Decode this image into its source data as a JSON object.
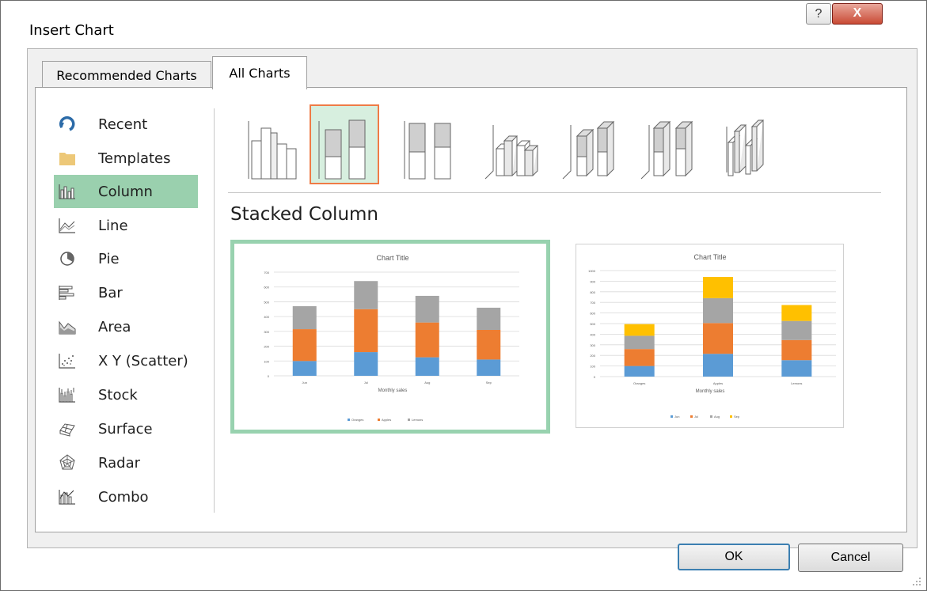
{
  "dialog": {
    "title": "Insert Chart",
    "help_label": "?",
    "close_label": "X"
  },
  "tabs": [
    {
      "label": "Recommended Charts",
      "active": false
    },
    {
      "label": "All Charts",
      "active": true
    }
  ],
  "sidebar": {
    "items": [
      {
        "label": "Recent",
        "icon": "recent-icon"
      },
      {
        "label": "Templates",
        "icon": "folder-icon"
      },
      {
        "label": "Column",
        "icon": "column-chart-icon",
        "selected": true
      },
      {
        "label": "Line",
        "icon": "line-chart-icon"
      },
      {
        "label": "Pie",
        "icon": "pie-chart-icon"
      },
      {
        "label": "Bar",
        "icon": "bar-chart-icon"
      },
      {
        "label": "Area",
        "icon": "area-chart-icon"
      },
      {
        "label": "X Y (Scatter)",
        "icon": "scatter-chart-icon"
      },
      {
        "label": "Stock",
        "icon": "stock-chart-icon"
      },
      {
        "label": "Surface",
        "icon": "surface-chart-icon"
      },
      {
        "label": "Radar",
        "icon": "radar-chart-icon"
      },
      {
        "label": "Combo",
        "icon": "combo-chart-icon"
      }
    ]
  },
  "subtypes": [
    {
      "icon": "clustered-column-icon"
    },
    {
      "icon": "stacked-column-icon",
      "selected": true
    },
    {
      "icon": "100-stacked-column-icon"
    },
    {
      "icon": "3d-clustered-column-icon"
    },
    {
      "icon": "3d-stacked-column-icon"
    },
    {
      "icon": "3d-100-stacked-column-icon"
    },
    {
      "icon": "3d-column-icon"
    }
  ],
  "main": {
    "heading": "Stacked Column"
  },
  "colors": {
    "blue": "#5b9bd5",
    "orange": "#ed7d31",
    "gray": "#a5a5a5",
    "yellow": "#ffc000",
    "selection": "#9ad0ae",
    "subtype_border": "#ef7b46"
  },
  "chart_data": [
    {
      "type": "bar",
      "stacked": true,
      "title": "Chart Title",
      "xlabel": "Monthly sales",
      "categories": [
        "Jun",
        "Jul",
        "Aug",
        "Sep"
      ],
      "series": [
        {
          "name": "Oranges",
          "values": [
            100,
            160,
            125,
            110
          ],
          "color": "#5b9bd5"
        },
        {
          "name": "Apples",
          "values": [
            215,
            290,
            235,
            200
          ],
          "color": "#ed7d31"
        },
        {
          "name": "Lemons",
          "values": [
            155,
            190,
            180,
            150
          ],
          "color": "#a5a5a5"
        }
      ],
      "ylim": [
        0,
        700
      ],
      "yticks": [
        "700",
        "600",
        "500",
        "400",
        "300",
        "200",
        "100",
        "0"
      ],
      "legend": "bottom",
      "grid": true
    },
    {
      "type": "bar",
      "stacked": true,
      "title": "Chart Title",
      "xlabel": "Monthly sales",
      "categories": [
        "Oranges",
        "Apples",
        "Lemons"
      ],
      "series": [
        {
          "name": "Jun",
          "values": [
            100,
            215,
            155
          ],
          "color": "#5b9bd5"
        },
        {
          "name": "Jul",
          "values": [
            160,
            290,
            190
          ],
          "color": "#ed7d31"
        },
        {
          "name": "Aug",
          "values": [
            125,
            235,
            180
          ],
          "color": "#a5a5a5"
        },
        {
          "name": "Sep",
          "values": [
            110,
            200,
            150
          ],
          "color": "#ffc000"
        }
      ],
      "ylim": [
        0,
        1000
      ],
      "yticks": [
        "1000",
        "900",
        "800",
        "700",
        "600",
        "500",
        "400",
        "300",
        "200",
        "100",
        "0"
      ],
      "legend": "bottom",
      "grid": true
    }
  ],
  "buttons": {
    "ok": "OK",
    "cancel": "Cancel"
  }
}
